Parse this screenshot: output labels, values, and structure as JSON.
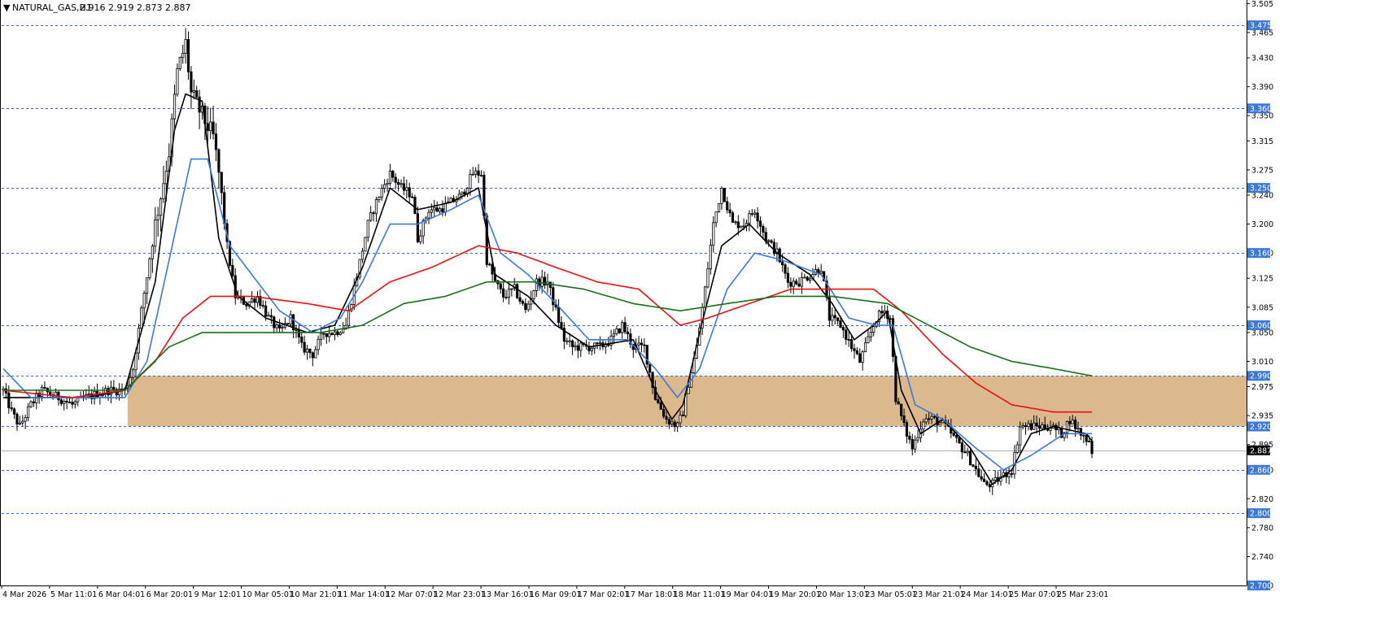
{
  "header": {
    "symbol": "NATURAL_GAS,H1",
    "ohlc": "2.916 2.919 2.873 2.887"
  },
  "colors": {
    "candle": "#000000",
    "ma_fast": "#000000",
    "ma_mid": "#3c78d8",
    "ma_slow": "#e81010",
    "ma_long": "#1a6e1a",
    "zone_fill": "#dcb98c",
    "level_line": "#3c64c8",
    "price_label_bg": "#000000",
    "level_label_bg": "#3c78d8"
  },
  "chart_data": {
    "type": "candlestick",
    "ylim": [
      2.7,
      3.51
    ],
    "y_ticks": [
      "3.505",
      "3.465",
      "3.430",
      "3.390",
      "3.350",
      "3.315",
      "3.275",
      "3.240",
      "3.200",
      "3.160",
      "3.125",
      "3.085",
      "3.050",
      "3.010",
      "2.975",
      "2.935",
      "2.895",
      "2.860",
      "2.820",
      "2.780",
      "2.740",
      "2.700"
    ],
    "x_ticks": [
      "4 Mar 2026",
      "5 Mar 11:01",
      "6 Mar 04:01",
      "6 Mar 20:01",
      "9 Mar 12:01",
      "10 Mar 05:01",
      "10 Mar 21:01",
      "11 Mar 14:01",
      "12 Mar 07:01",
      "12 Mar 23:01",
      "13 Mar 16:01",
      "16 Mar 09:01",
      "17 Mar 02:01",
      "17 Mar 18:01",
      "18 Mar 11:01",
      "19 Mar 04:01",
      "19 Mar 20:01",
      "20 Mar 13:01",
      "23 Mar 05:01",
      "23 Mar 21:01",
      "24 Mar 14:01",
      "25 Mar 07:01",
      "25 Mar 23:01"
    ],
    "levels": [
      "3.475",
      "3.360",
      "3.250",
      "3.160",
      "3.060",
      "2.990",
      "2.920",
      "2.860",
      "2.800",
      "2.700"
    ],
    "current_price": "2.887",
    "zone": {
      "low": 2.92,
      "high": 2.99,
      "start_bar": 45
    },
    "bar_count": 400,
    "close_anchors": [
      [
        0,
        2.97
      ],
      [
        3,
        2.94
      ],
      [
        6,
        2.92
      ],
      [
        10,
        2.95
      ],
      [
        14,
        2.97
      ],
      [
        20,
        2.96
      ],
      [
        25,
        2.95
      ],
      [
        30,
        2.96
      ],
      [
        38,
        2.97
      ],
      [
        44,
        2.97
      ],
      [
        47,
        3.0
      ],
      [
        50,
        3.08
      ],
      [
        54,
        3.18
      ],
      [
        57,
        3.24
      ],
      [
        60,
        3.3
      ],
      [
        63,
        3.41
      ],
      [
        66,
        3.45
      ],
      [
        68,
        3.38
      ],
      [
        72,
        3.35
      ],
      [
        76,
        3.32
      ],
      [
        78,
        3.27
      ],
      [
        81,
        3.17
      ],
      [
        84,
        3.1
      ],
      [
        88,
        3.09
      ],
      [
        92,
        3.1
      ],
      [
        96,
        3.07
      ],
      [
        100,
        3.05
      ],
      [
        104,
        3.07
      ],
      [
        108,
        3.03
      ],
      [
        112,
        3.02
      ],
      [
        116,
        3.05
      ],
      [
        120,
        3.05
      ],
      [
        124,
        3.06
      ],
      [
        128,
        3.13
      ],
      [
        132,
        3.2
      ],
      [
        136,
        3.24
      ],
      [
        140,
        3.27
      ],
      [
        144,
        3.25
      ],
      [
        148,
        3.24
      ],
      [
        150,
        3.18
      ],
      [
        154,
        3.22
      ],
      [
        158,
        3.22
      ],
      [
        162,
        3.23
      ],
      [
        166,
        3.24
      ],
      [
        170,
        3.27
      ],
      [
        173,
        3.27
      ],
      [
        175,
        3.15
      ],
      [
        178,
        3.12
      ],
      [
        181,
        3.1
      ],
      [
        185,
        3.11
      ],
      [
        189,
        3.08
      ],
      [
        193,
        3.12
      ],
      [
        197,
        3.12
      ],
      [
        200,
        3.08
      ],
      [
        203,
        3.04
      ],
      [
        206,
        3.03
      ],
      [
        212,
        3.03
      ],
      [
        216,
        3.03
      ],
      [
        220,
        3.04
      ],
      [
        224,
        3.06
      ],
      [
        228,
        3.03
      ],
      [
        232,
        3.03
      ],
      [
        236,
        2.96
      ],
      [
        240,
        2.93
      ],
      [
        244,
        2.92
      ],
      [
        246,
        2.94
      ],
      [
        248,
        2.98
      ],
      [
        251,
        3.03
      ],
      [
        254,
        3.11
      ],
      [
        257,
        3.2
      ],
      [
        260,
        3.25
      ],
      [
        264,
        3.2
      ],
      [
        268,
        3.2
      ],
      [
        272,
        3.22
      ],
      [
        276,
        3.18
      ],
      [
        280,
        3.16
      ],
      [
        284,
        3.12
      ],
      [
        288,
        3.12
      ],
      [
        292,
        3.13
      ],
      [
        296,
        3.14
      ],
      [
        299,
        3.07
      ],
      [
        303,
        3.06
      ],
      [
        307,
        3.03
      ],
      [
        310,
        3.01
      ],
      [
        313,
        3.04
      ],
      [
        316,
        3.07
      ],
      [
        319,
        3.08
      ],
      [
        321,
        3.07
      ],
      [
        323,
        2.96
      ],
      [
        326,
        2.92
      ],
      [
        329,
        2.89
      ],
      [
        333,
        2.93
      ],
      [
        337,
        2.93
      ],
      [
        341,
        2.92
      ],
      [
        345,
        2.9
      ],
      [
        349,
        2.88
      ],
      [
        352,
        2.86
      ],
      [
        355,
        2.84
      ],
      [
        358,
        2.84
      ],
      [
        361,
        2.85
      ],
      [
        365,
        2.86
      ],
      [
        368,
        2.92
      ],
      [
        371,
        2.92
      ],
      [
        375,
        2.92
      ],
      [
        379,
        2.92
      ],
      [
        383,
        2.91
      ],
      [
        386,
        2.93
      ],
      [
        390,
        2.91
      ],
      [
        393,
        2.9
      ],
      [
        394,
        2.887
      ]
    ],
    "series": [
      {
        "name": "",
        "ma_key": "ma_fast",
        "points": [
          [
            0,
            2.96
          ],
          [
            10,
            2.96
          ],
          [
            30,
            2.96
          ],
          [
            44,
            2.97
          ],
          [
            55,
            3.12
          ],
          [
            62,
            3.33
          ],
          [
            66,
            3.38
          ],
          [
            72,
            3.37
          ],
          [
            78,
            3.18
          ],
          [
            85,
            3.1
          ],
          [
            95,
            3.07
          ],
          [
            110,
            3.05
          ],
          [
            120,
            3.06
          ],
          [
            130,
            3.14
          ],
          [
            140,
            3.25
          ],
          [
            150,
            3.22
          ],
          [
            162,
            3.23
          ],
          [
            172,
            3.25
          ],
          [
            178,
            3.13
          ],
          [
            190,
            3.1
          ],
          [
            200,
            3.06
          ],
          [
            212,
            3.03
          ],
          [
            228,
            3.04
          ],
          [
            236,
            2.97
          ],
          [
            242,
            2.93
          ],
          [
            246,
            2.95
          ],
          [
            252,
            3.05
          ],
          [
            260,
            3.17
          ],
          [
            270,
            3.2
          ],
          [
            280,
            3.16
          ],
          [
            292,
            3.13
          ],
          [
            300,
            3.09
          ],
          [
            308,
            3.04
          ],
          [
            315,
            3.06
          ],
          [
            320,
            3.08
          ],
          [
            325,
            2.97
          ],
          [
            332,
            2.91
          ],
          [
            340,
            2.93
          ],
          [
            350,
            2.89
          ],
          [
            358,
            2.84
          ],
          [
            365,
            2.86
          ],
          [
            372,
            2.91
          ],
          [
            380,
            2.92
          ],
          [
            392,
            2.91
          ],
          [
            394,
            2.9
          ]
        ]
      },
      {
        "name": "",
        "ma_key": "ma_mid",
        "points": [
          [
            0,
            3.0
          ],
          [
            10,
            2.96
          ],
          [
            30,
            2.96
          ],
          [
            44,
            2.96
          ],
          [
            52,
            3.01
          ],
          [
            60,
            3.15
          ],
          [
            68,
            3.29
          ],
          [
            74,
            3.29
          ],
          [
            82,
            3.17
          ],
          [
            90,
            3.13
          ],
          [
            100,
            3.08
          ],
          [
            112,
            3.05
          ],
          [
            122,
            3.07
          ],
          [
            130,
            3.12
          ],
          [
            140,
            3.2
          ],
          [
            150,
            3.2
          ],
          [
            162,
            3.22
          ],
          [
            172,
            3.24
          ],
          [
            180,
            3.16
          ],
          [
            190,
            3.13
          ],
          [
            200,
            3.09
          ],
          [
            212,
            3.04
          ],
          [
            226,
            3.04
          ],
          [
            236,
            3.0
          ],
          [
            244,
            2.96
          ],
          [
            252,
            3.0
          ],
          [
            262,
            3.11
          ],
          [
            272,
            3.16
          ],
          [
            282,
            3.15
          ],
          [
            296,
            3.13
          ],
          [
            306,
            3.07
          ],
          [
            316,
            3.06
          ],
          [
            322,
            3.06
          ],
          [
            330,
            2.95
          ],
          [
            340,
            2.93
          ],
          [
            352,
            2.89
          ],
          [
            362,
            2.86
          ],
          [
            372,
            2.88
          ],
          [
            384,
            2.91
          ],
          [
            394,
            2.91
          ]
        ]
      },
      {
        "name": "",
        "ma_key": "ma_slow",
        "points": [
          [
            0,
            2.97
          ],
          [
            25,
            2.96
          ],
          [
            44,
            2.97
          ],
          [
            55,
            3.01
          ],
          [
            65,
            3.07
          ],
          [
            75,
            3.1
          ],
          [
            90,
            3.1
          ],
          [
            110,
            3.09
          ],
          [
            125,
            3.08
          ],
          [
            140,
            3.12
          ],
          [
            155,
            3.14
          ],
          [
            172,
            3.17
          ],
          [
            186,
            3.16
          ],
          [
            200,
            3.14
          ],
          [
            215,
            3.12
          ],
          [
            230,
            3.11
          ],
          [
            245,
            3.06
          ],
          [
            255,
            3.07
          ],
          [
            270,
            3.09
          ],
          [
            285,
            3.11
          ],
          [
            300,
            3.11
          ],
          [
            315,
            3.11
          ],
          [
            325,
            3.08
          ],
          [
            340,
            3.02
          ],
          [
            352,
            2.98
          ],
          [
            365,
            2.95
          ],
          [
            380,
            2.94
          ],
          [
            394,
            2.94
          ]
        ]
      },
      {
        "name": "",
        "ma_key": "ma_long",
        "points": [
          [
            0,
            2.97
          ],
          [
            25,
            2.97
          ],
          [
            44,
            2.97
          ],
          [
            60,
            3.03
          ],
          [
            72,
            3.05
          ],
          [
            90,
            3.05
          ],
          [
            115,
            3.05
          ],
          [
            130,
            3.06
          ],
          [
            145,
            3.09
          ],
          [
            160,
            3.1
          ],
          [
            175,
            3.12
          ],
          [
            192,
            3.12
          ],
          [
            210,
            3.11
          ],
          [
            228,
            3.09
          ],
          [
            245,
            3.08
          ],
          [
            262,
            3.09
          ],
          [
            280,
            3.1
          ],
          [
            300,
            3.1
          ],
          [
            320,
            3.09
          ],
          [
            335,
            3.06
          ],
          [
            350,
            3.03
          ],
          [
            365,
            3.01
          ],
          [
            380,
            3.0
          ],
          [
            394,
            2.99
          ]
        ]
      }
    ]
  }
}
